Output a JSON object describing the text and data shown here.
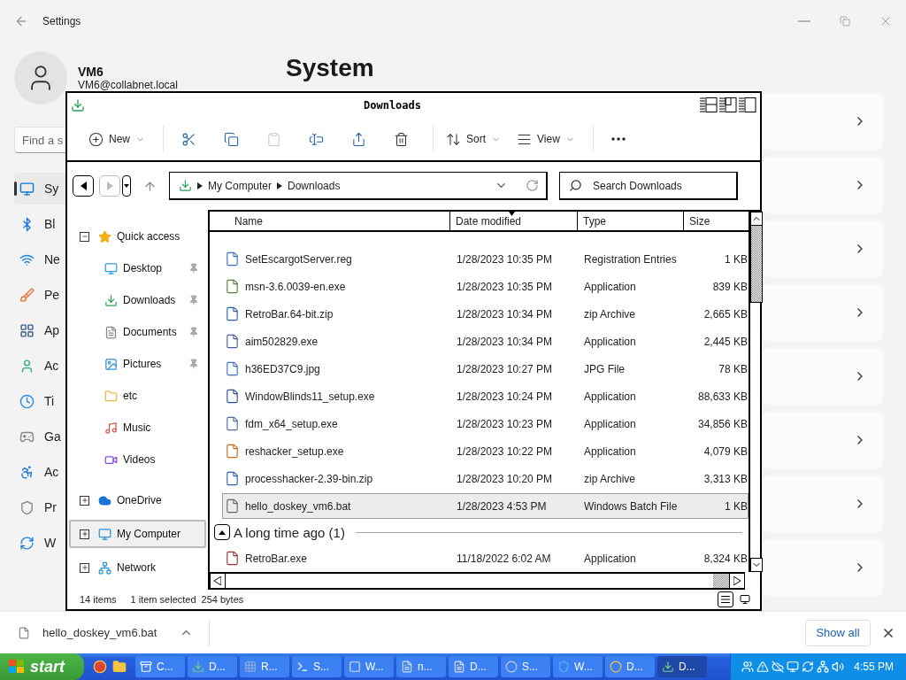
{
  "settings": {
    "title": "Settings",
    "user": {
      "name": "VM6",
      "email": "VM6@collabnet.local"
    },
    "heading": "System",
    "search": {
      "placeholder": "Find a s"
    },
    "nav": [
      {
        "label": "Sy",
        "selected": true
      },
      {
        "label": "Bl",
        "selected": false
      },
      {
        "label": "Ne",
        "selected": false
      },
      {
        "label": "Pe",
        "selected": false
      },
      {
        "label": "Ap",
        "selected": false
      },
      {
        "label": "Ac",
        "selected": false
      },
      {
        "label": "Ti",
        "selected": false
      },
      {
        "label": "Ga",
        "selected": false
      },
      {
        "label": "Ac",
        "selected": false
      },
      {
        "label": "Pr",
        "selected": false
      },
      {
        "label": "W",
        "selected": false
      }
    ]
  },
  "explorer": {
    "title": "Downloads",
    "toolbar": [
      {
        "kind": "new",
        "label": "New",
        "disabled": false
      },
      {
        "kind": "cut",
        "disabled": false
      },
      {
        "kind": "copy",
        "disabled": false
      },
      {
        "kind": "paste",
        "disabled": true
      },
      {
        "kind": "rename",
        "disabled": false
      },
      {
        "kind": "share",
        "disabled": false
      },
      {
        "kind": "delete",
        "disabled": false
      },
      {
        "kind": "sort",
        "label": "Sort",
        "disabled": false
      },
      {
        "kind": "view",
        "label": "View",
        "disabled": false
      },
      {
        "kind": "more",
        "disabled": false
      }
    ],
    "back": {
      "disabled": false
    },
    "forward": {
      "disabled": true
    },
    "address": [
      "My Computer",
      "Downloads"
    ],
    "search": {
      "placeholder": "Search Downloads"
    },
    "tree": [
      {
        "label": "Quick access",
        "expanded": true,
        "selected": false,
        "children": [
          {
            "label": "Desktop",
            "pinned": true,
            "selected": false
          },
          {
            "label": "Downloads",
            "pinned": true,
            "selected": false
          },
          {
            "label": "Documents",
            "pinned": true,
            "selected": false
          },
          {
            "label": "Pictures",
            "pinned": true,
            "selected": false
          },
          {
            "label": "etc",
            "pinned": false,
            "selected": false
          },
          {
            "label": "Music",
            "pinned": false,
            "selected": false
          },
          {
            "label": "Videos",
            "pinned": false,
            "selected": false
          }
        ]
      },
      {
        "label": "OneDrive",
        "expanded": false,
        "selected": false
      },
      {
        "label": "My Computer",
        "expanded": false,
        "selected": true
      },
      {
        "label": "Network",
        "expanded": false,
        "selected": false
      }
    ],
    "columns": [
      {
        "label": "Name",
        "sorted": false
      },
      {
        "label": "Date modified",
        "sorted": true
      },
      {
        "label": "Type",
        "sorted": false
      },
      {
        "label": "Size",
        "sorted": false
      }
    ],
    "groups": [
      {
        "rows": [
          {
            "name": "SetEscargotServer.reg",
            "date": "1/28/2023 10:35 PM",
            "type": "Registration Entries",
            "size": "1 KB",
            "selected": false
          },
          {
            "name": "msn-3.6.0039-en.exe",
            "date": "1/28/2023 10:35 PM",
            "type": "Application",
            "size": "839 KB",
            "selected": false
          },
          {
            "name": "RetroBar.64-bit.zip",
            "date": "1/28/2023 10:34 PM",
            "type": "zip Archive",
            "size": "2,665 KB",
            "selected": false
          },
          {
            "name": "aim502829.exe",
            "date": "1/28/2023 10:34 PM",
            "type": "Application",
            "size": "2,445 KB",
            "selected": false
          },
          {
            "name": "h36ED37C9.jpg",
            "date": "1/28/2023 10:27 PM",
            "type": "JPG File",
            "size": "78 KB",
            "selected": false
          },
          {
            "name": "WindowBlinds11_setup.exe",
            "date": "1/28/2023 10:24 PM",
            "type": "Application",
            "size": "88,633 KB",
            "selected": false
          },
          {
            "name": "fdm_x64_setup.exe",
            "date": "1/28/2023 10:23 PM",
            "type": "Application",
            "size": "34,856 KB",
            "selected": false
          },
          {
            "name": "reshacker_setup.exe",
            "date": "1/28/2023 10:22 PM",
            "type": "Application",
            "size": "4,079 KB",
            "selected": false
          },
          {
            "name": "processhacker-2.39-bin.zip",
            "date": "1/28/2023 10:20 PM",
            "type": "zip Archive",
            "size": "3,313 KB",
            "selected": false
          },
          {
            "name": "hello_doskey_vm6.bat",
            "date": "1/28/2023 4:53 PM",
            "type": "Windows Batch File",
            "size": "1 KB",
            "selected": true
          }
        ]
      },
      {
        "label": "A long time ago (1)",
        "expanded": true,
        "rows": [
          {
            "name": "RetroBar.exe",
            "date": "11/18/2022 6:02 AM",
            "type": "Application",
            "size": "8,324 KB",
            "selected": false
          }
        ]
      }
    ],
    "status": {
      "count": "14 items",
      "selection": "1 item selected",
      "size": "254 bytes"
    },
    "views": [
      {
        "kind": "details",
        "selected": true
      },
      {
        "kind": "tiles",
        "selected": false
      }
    ]
  },
  "download_bar": {
    "file": "hello_doskey_vm6.bat",
    "show_all": "Show all"
  },
  "taskbar": {
    "start": "start",
    "tasks": [
      {
        "label": "C...",
        "selected": false
      },
      {
        "label": "D...",
        "selected": false
      },
      {
        "label": "R...",
        "selected": false
      },
      {
        "label": "S...",
        "selected": false
      },
      {
        "label": "W...",
        "selected": false
      },
      {
        "label": "n...",
        "selected": false
      },
      {
        "label": "D...",
        "selected": false
      },
      {
        "label": "S...",
        "selected": false
      },
      {
        "label": "W...",
        "selected": false
      },
      {
        "label": "D...",
        "selected": false
      },
      {
        "label": "D...",
        "selected": true
      }
    ],
    "clock": "4:55 PM"
  }
}
